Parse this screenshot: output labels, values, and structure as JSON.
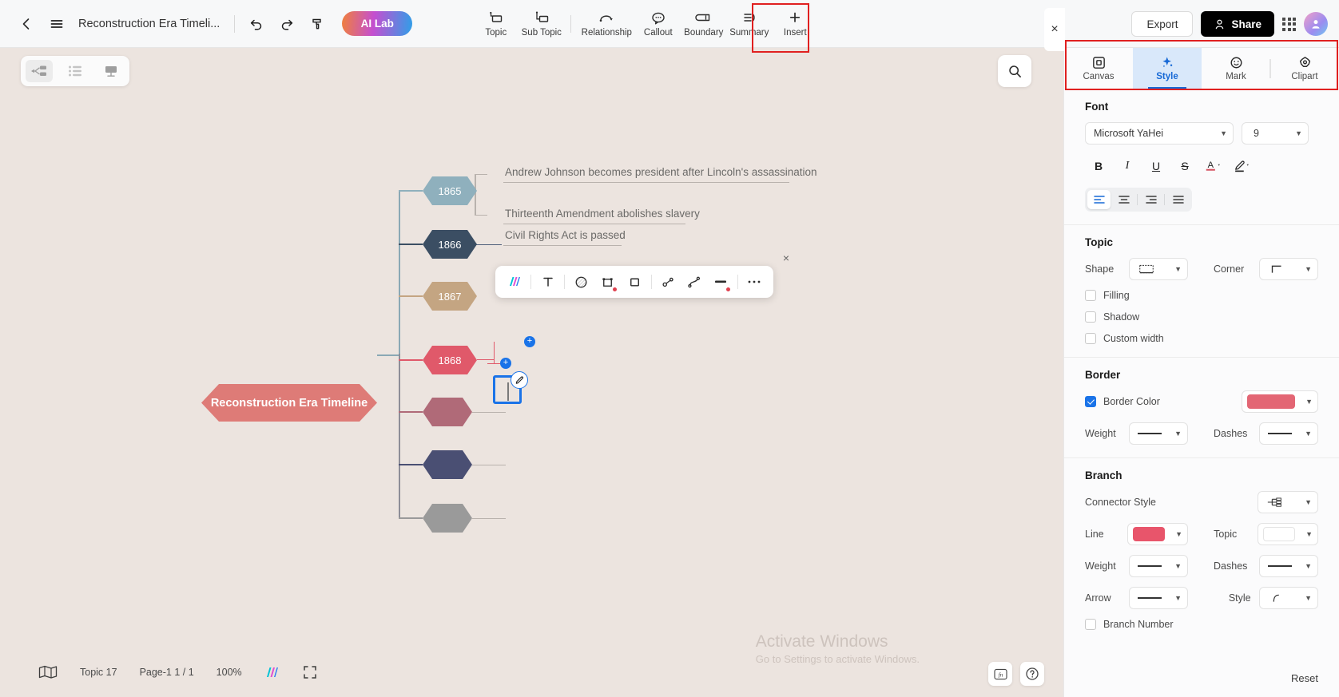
{
  "topbar": {
    "back_icon": "chevron-left-icon",
    "menu_icon": "hamburger-menu-icon",
    "doc_title": "Reconstruction Era Timeli...",
    "undo_icon": "undo-icon",
    "redo_icon": "redo-icon",
    "format_painter_icon": "format-painter-icon",
    "ai_lab_label": "AI Lab",
    "tools": [
      {
        "label": "Topic",
        "icon": "topic-icon"
      },
      {
        "label": "Sub Topic",
        "icon": "sub-topic-icon"
      },
      {
        "label": "Relationship",
        "icon": "relationship-icon"
      },
      {
        "label": "Callout",
        "icon": "callout-icon"
      },
      {
        "label": "Boundary",
        "icon": "boundary-icon"
      },
      {
        "label": "Summary",
        "icon": "summary-icon"
      },
      {
        "label": "Insert",
        "icon": "plus-icon"
      }
    ],
    "export_label": "Export",
    "share_label": "Share",
    "apps_icon": "apps-grid-icon",
    "avatar_icon": "user-avatar"
  },
  "canvas": {
    "viewmodes": [
      {
        "name": "mindmap-view",
        "active": true
      },
      {
        "name": "outline-view",
        "active": false
      },
      {
        "name": "presentation-view",
        "active": false
      }
    ],
    "search_icon": "search-icon",
    "panel_close_icon": "close-panel-icon",
    "watermark_line1": "Activate Windows",
    "watermark_line2": "Go to Settings to activate Windows."
  },
  "mindmap": {
    "root": {
      "label": "Reconstruction Era Timeline",
      "color": "#de7b77"
    },
    "nodes": [
      {
        "year": "1865",
        "color": "#8fb0bd",
        "items": [
          "Andrew Johnson becomes president after Lincoln's assassination",
          "Thirteenth Amendment abolishes slavery"
        ]
      },
      {
        "year": "1866",
        "color": "#3b4e63",
        "items": [
          "Civil Rights Act is passed"
        ]
      },
      {
        "year": "1867",
        "color": "#c4a582",
        "items": []
      },
      {
        "year": "1868",
        "color": "#e0596a",
        "items": []
      },
      {
        "year": "",
        "color": "#b06a78",
        "items": []
      },
      {
        "year": "",
        "color": "#4a4f73",
        "items": []
      },
      {
        "year": "",
        "color": "#9a9a9a",
        "items": []
      }
    ]
  },
  "float_toolbar": {
    "buttons": [
      {
        "name": "ai-format-icon"
      },
      {
        "name": "text-style-icon"
      },
      {
        "name": "fill-color-icon"
      },
      {
        "name": "shape-icon"
      },
      {
        "name": "border-icon"
      },
      {
        "name": "relationship-icon"
      },
      {
        "name": "branch-icon"
      },
      {
        "name": "line-color-icon"
      },
      {
        "name": "more-options-icon"
      }
    ],
    "close_icon": "close-icon"
  },
  "bottombar": {
    "map_icon": "map-overview-icon",
    "topic_count": "Topic 17",
    "page_label": "Page-1  1 / 1",
    "zoom": "100%",
    "ai_icon": "ai-icon",
    "fullscreen_icon": "fullscreen-icon",
    "fn_icon": "fn-icon",
    "help_icon": "help-icon"
  },
  "panel": {
    "tabs": [
      {
        "label": "Canvas",
        "icon": "canvas-icon",
        "active": false
      },
      {
        "label": "Style",
        "icon": "style-sparkle-icon",
        "active": true
      },
      {
        "label": "Mark",
        "icon": "mark-smiley-icon",
        "active": false
      },
      {
        "label": "Clipart",
        "icon": "clipart-star-icon",
        "active": false
      }
    ],
    "font": {
      "title": "Font",
      "family": "Microsoft YaHei",
      "size": "9",
      "bold_label": "B",
      "italic_label": "I",
      "underline_label": "U",
      "strike_label": "S",
      "text_color_label": "A",
      "highlight_icon": "highlight-pen-icon",
      "align_options": [
        "align-left",
        "align-center",
        "align-right",
        "align-justify"
      ],
      "align_active": "align-left"
    },
    "topic": {
      "title": "Topic",
      "shape_label": "Shape",
      "shape_value_icon": "dashed-rect-icon",
      "corner_label": "Corner",
      "corner_value_icon": "square-corner-icon",
      "filling_label": "Filling",
      "filling_checked": false,
      "shadow_label": "Shadow",
      "shadow_checked": false,
      "custom_width_label": "Custom width",
      "custom_width_checked": false
    },
    "border": {
      "title": "Border",
      "border_color_label": "Border Color",
      "border_color_checked": true,
      "border_color": "#e36674",
      "weight_label": "Weight",
      "dashes_label": "Dashes"
    },
    "branch": {
      "title": "Branch",
      "connector_style_label": "Connector Style",
      "connector_icon": "connector-tree-icon",
      "line_label": "Line",
      "line_color": "#e8556b",
      "topic_label": "Topic",
      "topic_color": "#ffffff",
      "weight_label": "Weight",
      "dashes_label": "Dashes",
      "arrow_label": "Arrow",
      "style_label": "Style",
      "style_icon": "curve-icon",
      "branch_number_label": "Branch Number",
      "branch_number_checked": false
    },
    "reset_label": "Reset"
  }
}
